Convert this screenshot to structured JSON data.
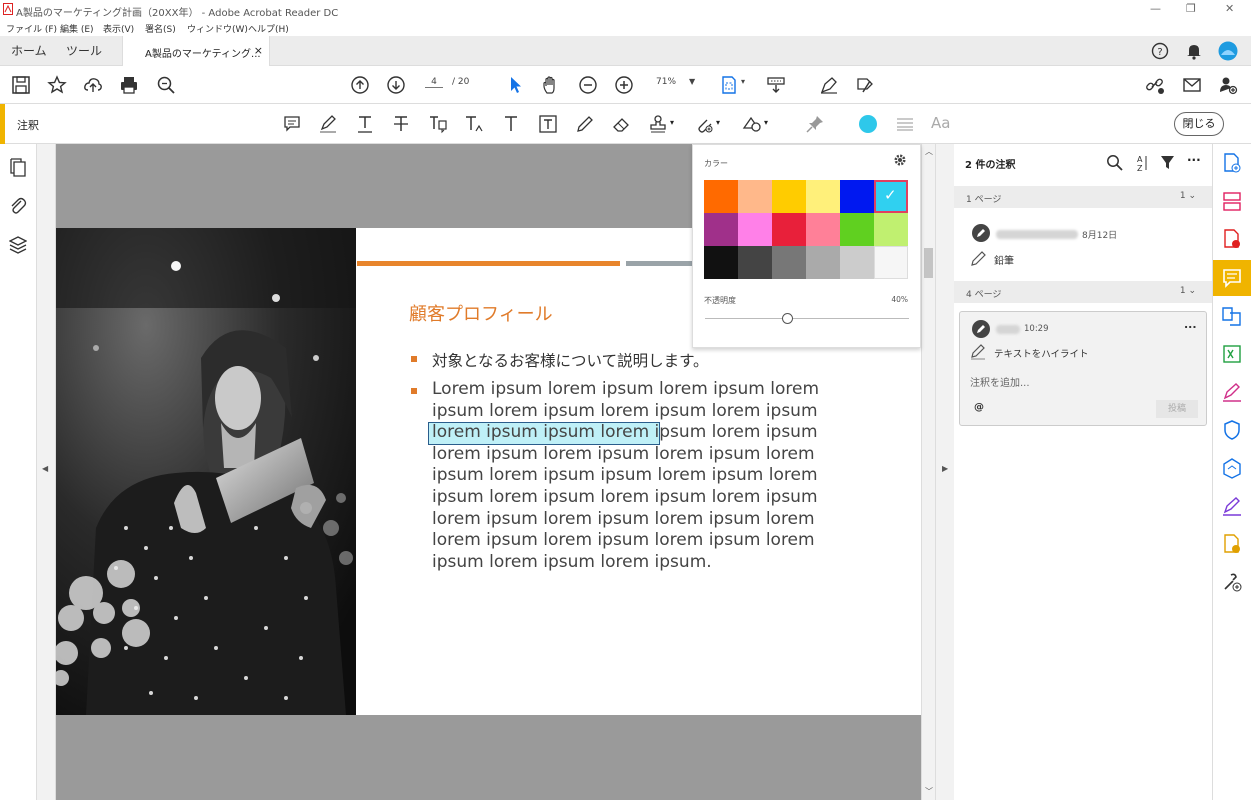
{
  "window": {
    "title": "A製品のマーケティング計画（20XX年） - Adobe Acrobat Reader DC",
    "menu": [
      "ファイル (F)",
      "編集 (E)",
      "表示(V)",
      "署名(S)",
      "ウィンドウ(W)",
      "ヘルプ(H)"
    ]
  },
  "tabs": {
    "home": "ホーム",
    "tools": "ツール",
    "document": "A製品のマーケティング...",
    "close": "×"
  },
  "toolbar": {
    "page_current": "4",
    "page_total": "/ 20",
    "zoom": "71%"
  },
  "comment_bar": {
    "title": "注釈",
    "font_label": "Aa",
    "close_label": "閉じる",
    "active_color": "#2ec8ea"
  },
  "color_popup": {
    "label": "カラー",
    "opacity_label": "不透明度",
    "opacity_value": "40%",
    "opacity_fraction": 0.4,
    "selected_swatch": 5,
    "swatches": [
      "#ff6a00",
      "#ffb88a",
      "#ffcc00",
      "#fff07a",
      "#0018f0",
      "#30d0f0",
      "#a0308a",
      "#ff80e8",
      "#e8203a",
      "#ff8098",
      "#60d020",
      "#c0f070",
      "#111111",
      "#444444",
      "#777777",
      "#aaaaaa",
      "#cccccc",
      "#f6f6f6"
    ]
  },
  "slide": {
    "title": "顧客プロフィール",
    "bullet1": "対象となるお客様について説明します。",
    "lorem_lines": [
      "Lorem ipsum lorem ipsum lorem ipsum lorem",
      "ipsum lorem ipsum lorem ipsum lorem ipsum",
      "lorem ipsum ipsum lorem ipsum lorem ipsum",
      "lorem ipsum lorem ipsum lorem ipsum lorem",
      "ipsum lorem ipsum ipsum lorem ipsum lorem",
      "ipsum lorem ipsum lorem ipsum lorem ipsum",
      "lorem ipsum lorem ipsum lorem ipsum lorem",
      "lorem ipsum lorem ipsum lorem ipsum lorem",
      "ipsum lorem ipsum lorem ipsum."
    ]
  },
  "comments_panel": {
    "heading": "2 件の注釈",
    "page1": {
      "label": "1 ページ",
      "count": "1"
    },
    "page4": {
      "label": "4 ページ",
      "count": "1"
    },
    "comment1": {
      "date": "8月12日",
      "type": "鉛筆"
    },
    "comment2": {
      "time": "10:29",
      "type": "テキストをハイライト",
      "reply_placeholder": "注釈を追加...",
      "mention": "@",
      "post": "投稿",
      "more": "..."
    }
  }
}
